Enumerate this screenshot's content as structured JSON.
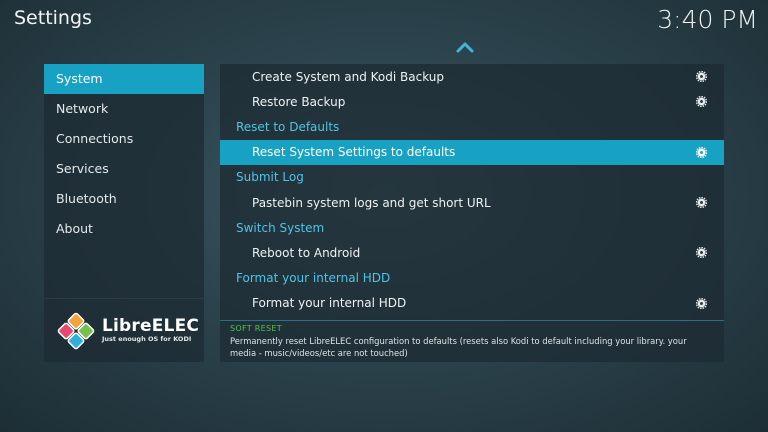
{
  "header": {
    "title": "Settings",
    "clock": "3:40 PM"
  },
  "sidebar": {
    "items": [
      {
        "label": "System",
        "active": true
      },
      {
        "label": "Network",
        "active": false
      },
      {
        "label": "Connections",
        "active": false
      },
      {
        "label": "Services",
        "active": false
      },
      {
        "label": "Bluetooth",
        "active": false
      },
      {
        "label": "About",
        "active": false
      }
    ],
    "logo": {
      "name": "LibreELEC",
      "tagline": "Just enough OS for KODI"
    }
  },
  "content": {
    "rows": [
      {
        "type": "item",
        "label": "Create System and Kodi Backup",
        "icon": "gear-icon"
      },
      {
        "type": "item",
        "label": "Restore Backup",
        "icon": "gear-icon"
      },
      {
        "type": "section",
        "label": "Reset to Defaults"
      },
      {
        "type": "item",
        "label": "Reset System Settings to defaults",
        "icon": "gear-icon",
        "active": true
      },
      {
        "type": "section",
        "label": "Submit Log"
      },
      {
        "type": "item",
        "label": "Pastebin system logs and get short URL",
        "icon": "gear-icon"
      },
      {
        "type": "section",
        "label": "Switch System"
      },
      {
        "type": "item",
        "label": "Reboot to Android",
        "icon": "gear-icon"
      },
      {
        "type": "section",
        "label": "Format your internal HDD"
      },
      {
        "type": "item",
        "label": "Format your internal HDD",
        "icon": "gear-icon"
      }
    ],
    "info": {
      "title": "SOFT RESET",
      "description": "Permanently reset LibreELEC configuration to defaults (resets also Kodi to default including your library. your media - music/videos/etc are not touched)"
    }
  },
  "colors": {
    "accent": "#17a2c4",
    "section_text": "#4ec4e6",
    "info_title": "#52c24a"
  }
}
